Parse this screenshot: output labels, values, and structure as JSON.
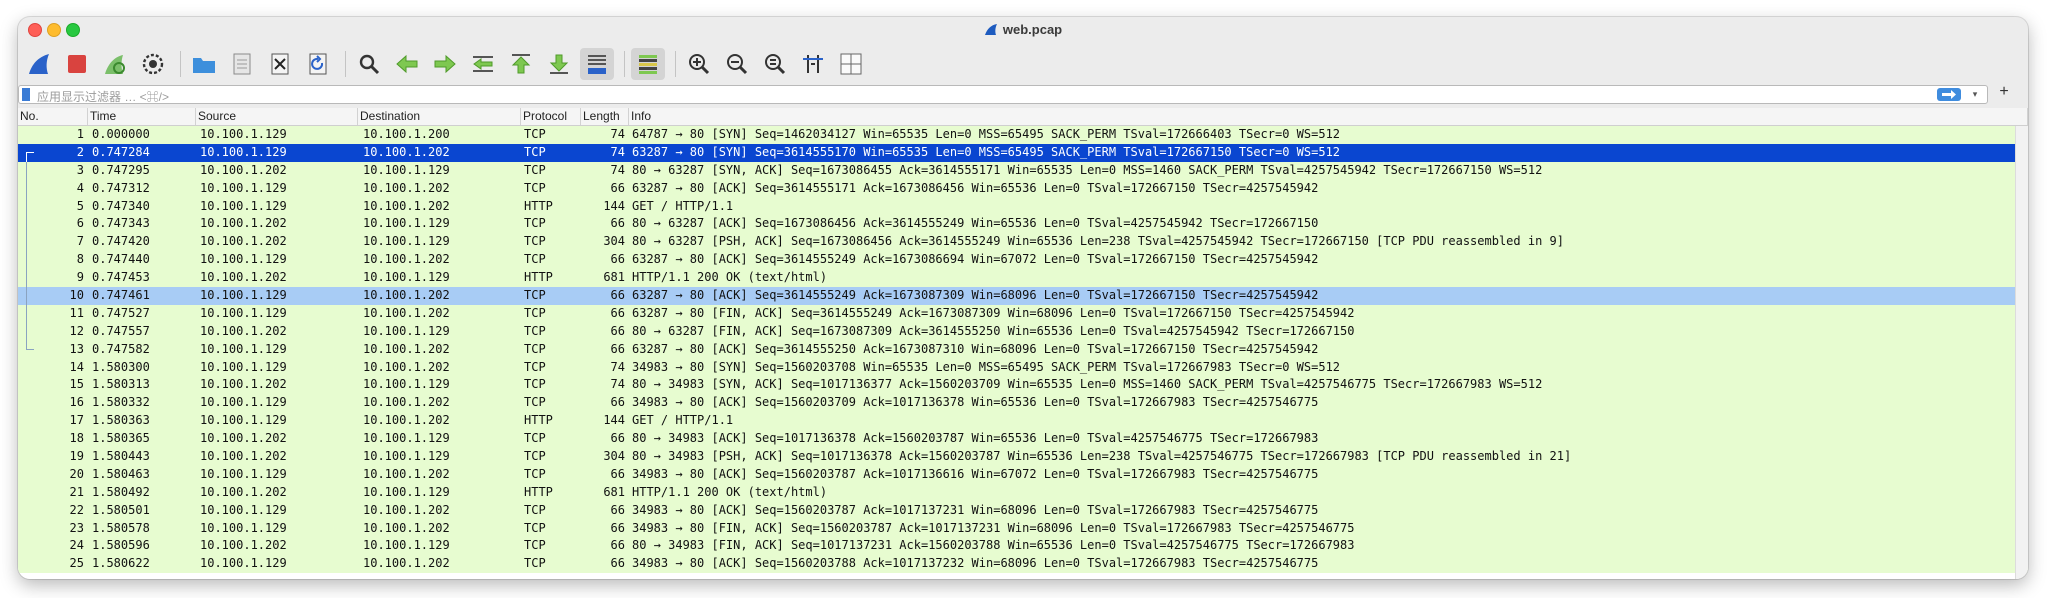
{
  "window": {
    "title": "web.pcap"
  },
  "toolbar": {
    "buttons": [
      {
        "name": "start-capture-icon"
      },
      {
        "name": "stop-capture-icon"
      },
      {
        "name": "restart-capture-icon"
      },
      {
        "name": "capture-options-icon"
      },
      {
        "name": "open-file-icon"
      },
      {
        "name": "save-file-icon"
      },
      {
        "name": "close-file-icon"
      },
      {
        "name": "reload-file-icon"
      },
      {
        "name": "find-packet-icon"
      },
      {
        "name": "go-back-icon"
      },
      {
        "name": "go-forward-icon"
      },
      {
        "name": "go-to-packet-icon"
      },
      {
        "name": "go-first-icon"
      },
      {
        "name": "go-last-icon"
      },
      {
        "name": "auto-scroll-icon"
      },
      {
        "name": "colorize-icon"
      },
      {
        "name": "zoom-in-icon"
      },
      {
        "name": "zoom-out-icon"
      },
      {
        "name": "zoom-normal-icon"
      },
      {
        "name": "resize-columns-icon"
      },
      {
        "name": "layout-icon"
      }
    ]
  },
  "filter": {
    "placeholder": "应用显示过滤器 … <⌘/>",
    "plus": "+"
  },
  "colors": {
    "row_bg": "#e7fcd0",
    "selected_bg": "#0a46d0",
    "related_bg": "#a8ccf5"
  },
  "columns": [
    "No.",
    "Time",
    "Source",
    "Destination",
    "Protocol",
    "Length",
    "Info"
  ],
  "packets": [
    {
      "no": "1",
      "time": "0.000000",
      "src": "10.100.1.129",
      "dst": "10.100.1.200",
      "proto": "TCP",
      "len": "74",
      "info": "64787 → 80 [SYN] Seq=1462034127 Win=65535 Len=0 MSS=65495 SACK_PERM TSval=172666403 TSecr=0 WS=512"
    },
    {
      "no": "2",
      "time": "0.747284",
      "src": "10.100.1.129",
      "dst": "10.100.1.202",
      "proto": "TCP",
      "len": "74",
      "info": "63287 → 80 [SYN] Seq=3614555170 Win=65535 Len=0 MSS=65495 SACK_PERM TSval=172667150 TSecr=0 WS=512"
    },
    {
      "no": "3",
      "time": "0.747295",
      "src": "10.100.1.202",
      "dst": "10.100.1.129",
      "proto": "TCP",
      "len": "74",
      "info": "80 → 63287 [SYN, ACK] Seq=1673086455 Ack=3614555171 Win=65535 Len=0 MSS=1460 SACK_PERM TSval=4257545942 TSecr=172667150 WS=512"
    },
    {
      "no": "4",
      "time": "0.747312",
      "src": "10.100.1.129",
      "dst": "10.100.1.202",
      "proto": "TCP",
      "len": "66",
      "info": "63287 → 80 [ACK] Seq=3614555171 Ack=1673086456 Win=65536 Len=0 TSval=172667150 TSecr=4257545942"
    },
    {
      "no": "5",
      "time": "0.747340",
      "src": "10.100.1.129",
      "dst": "10.100.1.202",
      "proto": "HTTP",
      "len": "144",
      "info": "GET / HTTP/1.1"
    },
    {
      "no": "6",
      "time": "0.747343",
      "src": "10.100.1.202",
      "dst": "10.100.1.129",
      "proto": "TCP",
      "len": "66",
      "info": "80 → 63287 [ACK] Seq=1673086456 Ack=3614555249 Win=65536 Len=0 TSval=4257545942 TSecr=172667150"
    },
    {
      "no": "7",
      "time": "0.747420",
      "src": "10.100.1.202",
      "dst": "10.100.1.129",
      "proto": "TCP",
      "len": "304",
      "info": "80 → 63287 [PSH, ACK] Seq=1673086456 Ack=3614555249 Win=65536 Len=238 TSval=4257545942 TSecr=172667150 [TCP PDU reassembled in 9]"
    },
    {
      "no": "8",
      "time": "0.747440",
      "src": "10.100.1.129",
      "dst": "10.100.1.202",
      "proto": "TCP",
      "len": "66",
      "info": "63287 → 80 [ACK] Seq=3614555249 Ack=1673086694 Win=67072 Len=0 TSval=172667150 TSecr=4257545942"
    },
    {
      "no": "9",
      "time": "0.747453",
      "src": "10.100.1.202",
      "dst": "10.100.1.129",
      "proto": "HTTP",
      "len": "681",
      "info": "HTTP/1.1 200 OK  (text/html)"
    },
    {
      "no": "10",
      "time": "0.747461",
      "src": "10.100.1.129",
      "dst": "10.100.1.202",
      "proto": "TCP",
      "len": "66",
      "info": "63287 → 80 [ACK] Seq=3614555249 Ack=1673087309 Win=68096 Len=0 TSval=172667150 TSecr=4257545942"
    },
    {
      "no": "11",
      "time": "0.747527",
      "src": "10.100.1.129",
      "dst": "10.100.1.202",
      "proto": "TCP",
      "len": "66",
      "info": "63287 → 80 [FIN, ACK] Seq=3614555249 Ack=1673087309 Win=68096 Len=0 TSval=172667150 TSecr=4257545942"
    },
    {
      "no": "12",
      "time": "0.747557",
      "src": "10.100.1.202",
      "dst": "10.100.1.129",
      "proto": "TCP",
      "len": "66",
      "info": "80 → 63287 [FIN, ACK] Seq=1673087309 Ack=3614555250 Win=65536 Len=0 TSval=4257545942 TSecr=172667150"
    },
    {
      "no": "13",
      "time": "0.747582",
      "src": "10.100.1.129",
      "dst": "10.100.1.202",
      "proto": "TCP",
      "len": "66",
      "info": "63287 → 80 [ACK] Seq=3614555250 Ack=1673087310 Win=68096 Len=0 TSval=172667150 TSecr=4257545942"
    },
    {
      "no": "14",
      "time": "1.580300",
      "src": "10.100.1.129",
      "dst": "10.100.1.202",
      "proto": "TCP",
      "len": "74",
      "info": "34983 → 80 [SYN] Seq=1560203708 Win=65535 Len=0 MSS=65495 SACK_PERM TSval=172667983 TSecr=0 WS=512"
    },
    {
      "no": "15",
      "time": "1.580313",
      "src": "10.100.1.202",
      "dst": "10.100.1.129",
      "proto": "TCP",
      "len": "74",
      "info": "80 → 34983 [SYN, ACK] Seq=1017136377 Ack=1560203709 Win=65535 Len=0 MSS=1460 SACK_PERM TSval=4257546775 TSecr=172667983 WS=512"
    },
    {
      "no": "16",
      "time": "1.580332",
      "src": "10.100.1.129",
      "dst": "10.100.1.202",
      "proto": "TCP",
      "len": "66",
      "info": "34983 → 80 [ACK] Seq=1560203709 Ack=1017136378 Win=65536 Len=0 TSval=172667983 TSecr=4257546775"
    },
    {
      "no": "17",
      "time": "1.580363",
      "src": "10.100.1.129",
      "dst": "10.100.1.202",
      "proto": "HTTP",
      "len": "144",
      "info": "GET / HTTP/1.1"
    },
    {
      "no": "18",
      "time": "1.580365",
      "src": "10.100.1.202",
      "dst": "10.100.1.129",
      "proto": "TCP",
      "len": "66",
      "info": "80 → 34983 [ACK] Seq=1017136378 Ack=1560203787 Win=65536 Len=0 TSval=4257546775 TSecr=172667983"
    },
    {
      "no": "19",
      "time": "1.580443",
      "src": "10.100.1.202",
      "dst": "10.100.1.129",
      "proto": "TCP",
      "len": "304",
      "info": "80 → 34983 [PSH, ACK] Seq=1017136378 Ack=1560203787 Win=65536 Len=238 TSval=4257546775 TSecr=172667983 [TCP PDU reassembled in 21]"
    },
    {
      "no": "20",
      "time": "1.580463",
      "src": "10.100.1.129",
      "dst": "10.100.1.202",
      "proto": "TCP",
      "len": "66",
      "info": "34983 → 80 [ACK] Seq=1560203787 Ack=1017136616 Win=67072 Len=0 TSval=172667983 TSecr=4257546775"
    },
    {
      "no": "21",
      "time": "1.580492",
      "src": "10.100.1.202",
      "dst": "10.100.1.129",
      "proto": "HTTP",
      "len": "681",
      "info": "HTTP/1.1 200 OK  (text/html)"
    },
    {
      "no": "22",
      "time": "1.580501",
      "src": "10.100.1.129",
      "dst": "10.100.1.202",
      "proto": "TCP",
      "len": "66",
      "info": "34983 → 80 [ACK] Seq=1560203787 Ack=1017137231 Win=68096 Len=0 TSval=172667983 TSecr=4257546775"
    },
    {
      "no": "23",
      "time": "1.580578",
      "src": "10.100.1.129",
      "dst": "10.100.1.202",
      "proto": "TCP",
      "len": "66",
      "info": "34983 → 80 [FIN, ACK] Seq=1560203787 Ack=1017137231 Win=68096 Len=0 TSval=172667983 TSecr=4257546775"
    },
    {
      "no": "24",
      "time": "1.580596",
      "src": "10.100.1.202",
      "dst": "10.100.1.129",
      "proto": "TCP",
      "len": "66",
      "info": "80 → 34983 [FIN, ACK] Seq=1017137231 Ack=1560203788 Win=65536 Len=0 TSval=4257546775 TSecr=172667983"
    },
    {
      "no": "25",
      "time": "1.580622",
      "src": "10.100.1.129",
      "dst": "10.100.1.202",
      "proto": "TCP",
      "len": "66",
      "info": "34983 → 80 [ACK] Seq=1560203788 Ack=1017137232 Win=68096 Len=0 TSval=172667983 TSecr=4257546775"
    }
  ],
  "selection": {
    "selected_no": "2",
    "related_no": "10",
    "conversation_first": "2",
    "conversation_last": "13"
  }
}
